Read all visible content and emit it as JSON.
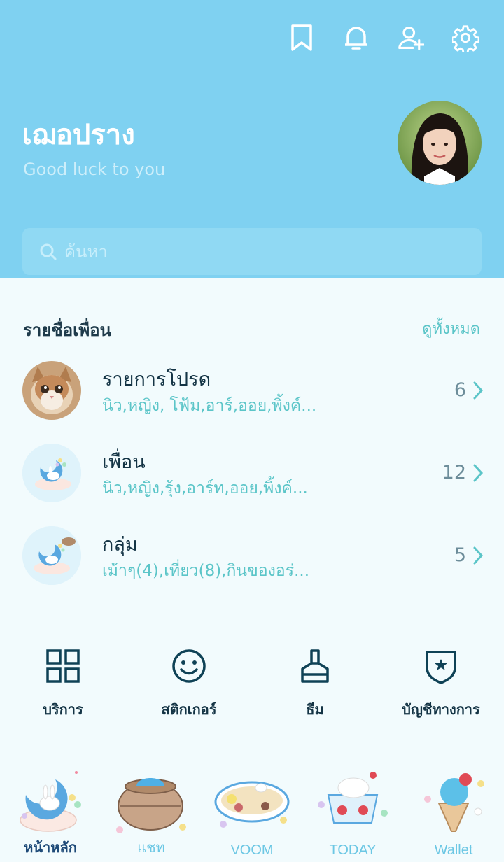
{
  "header": {
    "profile_name": "เฌอปราง",
    "status_message": "Good luck to you",
    "search_placeholder": "ค้นหา"
  },
  "friends_section": {
    "title": "รายชื่อเพื่อน",
    "see_all_label": "ดูทั้งหมด",
    "rows": [
      {
        "title": "รายการโปรด",
        "subtitle": "นิว,หญิง, โฟ้ม,อาร์,ออย,พิ้งค์...",
        "count": "6"
      },
      {
        "title": "เพื่อน",
        "subtitle": "นิว,หญิง,รุ้ง,อาร์ท,ออย,พิ้งค์...",
        "count": "12"
      },
      {
        "title": "กลุ่ม",
        "subtitle": "เม้าๆ(4),เที่ยว(8),กินของอร่...",
        "count": "5"
      }
    ]
  },
  "services": [
    {
      "label": "บริการ",
      "icon": "grid-icon"
    },
    {
      "label": "สติกเกอร์",
      "icon": "smiley-icon"
    },
    {
      "label": "ธีม",
      "icon": "brush-icon"
    },
    {
      "label": "บัญชีทางการ",
      "icon": "shield-star-icon"
    }
  ],
  "tabs": [
    {
      "label": "หน้าหลัก",
      "active": true
    },
    {
      "label": "แชท",
      "active": false
    },
    {
      "label": "VOOM",
      "active": false
    },
    {
      "label": "TODAY",
      "active": false
    },
    {
      "label": "Wallet",
      "active": false
    }
  ],
  "colors": {
    "header_bg": "#7fd1f1",
    "accent": "#5bc5c8",
    "text_dark": "#143445",
    "body_bg": "#f2fbfd"
  }
}
